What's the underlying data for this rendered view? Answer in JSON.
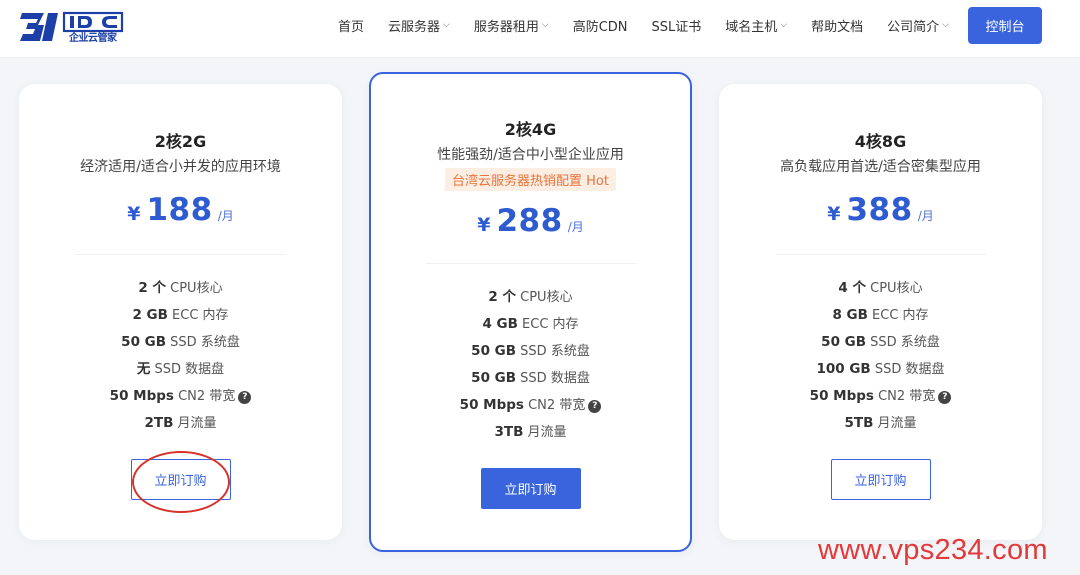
{
  "header": {
    "logo_text": "31IDC",
    "logo_sub": "企业云管家",
    "nav": [
      {
        "label": "首页",
        "has_dropdown": false
      },
      {
        "label": "云服务器",
        "has_dropdown": true
      },
      {
        "label": "服务器租用",
        "has_dropdown": true
      },
      {
        "label": "高防CDN",
        "has_dropdown": false
      },
      {
        "label": "SSL证书",
        "has_dropdown": false
      },
      {
        "label": "域名主机",
        "has_dropdown": true
      },
      {
        "label": "帮助文档",
        "has_dropdown": false
      },
      {
        "label": "公司简介",
        "has_dropdown": true
      }
    ],
    "console_label": "控制台"
  },
  "plans": [
    {
      "title": "2核2G",
      "desc": "经济适用/适合小并发的应用环境",
      "currency": "¥",
      "price": "188",
      "unit": "/月",
      "specs": [
        {
          "value": "2 个",
          "label": "CPU核心",
          "help": false
        },
        {
          "value": "2 GB",
          "label": "ECC 内存",
          "help": false
        },
        {
          "value": "50 GB",
          "label": "SSD 系统盘",
          "help": false
        },
        {
          "value": "无",
          "label": "SSD 数据盘",
          "help": false
        },
        {
          "value": "50 Mbps",
          "label": "CN2 带宽",
          "help": true
        },
        {
          "value": "2TB",
          "label": "月流量",
          "help": false
        }
      ],
      "button": "立即订购"
    },
    {
      "title": "2核4G",
      "desc": "性能强劲/适合中小型企业应用",
      "badge": "台湾云服务器热销配置 Hot",
      "currency": "¥",
      "price": "288",
      "unit": "/月",
      "specs": [
        {
          "value": "2 个",
          "label": "CPU核心",
          "help": false
        },
        {
          "value": "4 GB",
          "label": "ECC 内存",
          "help": false
        },
        {
          "value": "50 GB",
          "label": "SSD 系统盘",
          "help": false
        },
        {
          "value": "50 GB",
          "label": "SSD 数据盘",
          "help": false
        },
        {
          "value": "50 Mbps",
          "label": "CN2 带宽",
          "help": true
        },
        {
          "value": "3TB",
          "label": "月流量",
          "help": false
        }
      ],
      "button": "立即订购"
    },
    {
      "title": "4核8G",
      "desc": "高负载应用首选/适合密集型应用",
      "currency": "¥",
      "price": "388",
      "unit": "/月",
      "specs": [
        {
          "value": "4 个",
          "label": "CPU核心",
          "help": false
        },
        {
          "value": "8 GB",
          "label": "ECC 内存",
          "help": false
        },
        {
          "value": "50 GB",
          "label": "SSD 系统盘",
          "help": false
        },
        {
          "value": "100 GB",
          "label": "SSD 数据盘",
          "help": false
        },
        {
          "value": "50 Mbps",
          "label": "CN2 带宽",
          "help": true
        },
        {
          "value": "5TB",
          "label": "月流量",
          "help": false
        }
      ],
      "button": "立即订购"
    }
  ],
  "help_glyph": "?",
  "watermark": "www.vps234.com",
  "colors": {
    "accent": "#3a64dd",
    "price": "#2e5bd0",
    "badge_bg": "#fdeee4",
    "badge_text": "#e8743b",
    "annotation_circle": "#d8322b",
    "watermark": "#e23a3a"
  }
}
